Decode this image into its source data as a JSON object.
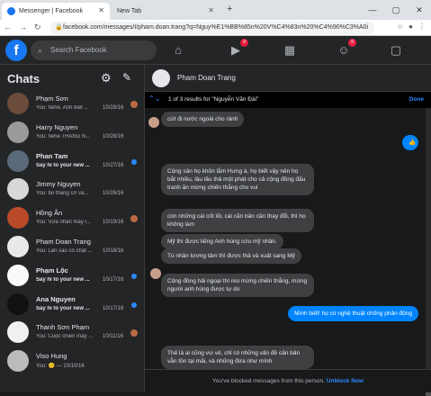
{
  "browser": {
    "active_tab_title": "Messenger | Facebook",
    "inactive_tab_title": "New Tab",
    "new_tab_glyph": "+",
    "url": "facebook.com/messages/t/pham.doan.trang?q=Nguy%E1%BB%85n%20V%C4%83n%20%C4%90%C3%A0i",
    "window_controls": [
      "—",
      "▢",
      "✕"
    ]
  },
  "fb": {
    "search_placeholder": "Search Facebook",
    "badge_watch": "9",
    "badge_groups": "9",
    "brand_color": "#1877f2"
  },
  "sidebar": {
    "title": "Chats",
    "chats": [
      {
        "name": "Phạm Sơn",
        "preview": "You: hehe. Anh biết ...",
        "date": "10/28/16",
        "avatar_color": "#6b4b3a",
        "state": "seen"
      },
      {
        "name": "Harry Nguyen",
        "preview": "You: hehe THẰNG N...",
        "date": "10/28/16",
        "avatar_color": "#9a9a9a",
        "state": "none"
      },
      {
        "name": "Phan Tam",
        "preview": "Say hi to your new ...",
        "date": "10/27/16",
        "avatar_color": "#5a6a7a",
        "state": "unread"
      },
      {
        "name": "Jimmy Nguyen",
        "preview": "You: bỏ thằng cờ và...",
        "date": "10/26/16",
        "avatar_color": "#d8d8d8",
        "state": "none"
      },
      {
        "name": "Hồng Ân",
        "preview": "You: Vừa nhắn mấy l...",
        "date": "10/19/16",
        "avatar_color": "#b84a2a",
        "state": "seen"
      },
      {
        "name": "Pham Doan Trang",
        "preview": "You: Lần sau có chat ...",
        "date": "10/18/16",
        "avatar_color": "#e8e8e8",
        "state": "none"
      },
      {
        "name": "Phạm Lộc",
        "preview": "Say hi to your new ...",
        "date": "10/17/16",
        "avatar_color": "#fafafa",
        "state": "unread"
      },
      {
        "name": "Ana Nguyen",
        "preview": "Say hi to your new ...",
        "date": "10/17/16",
        "avatar_color": "#111111",
        "state": "unread"
      },
      {
        "name": "Thanh Sơn Phạm",
        "preview": "You: Cuộc chiến mấy ...",
        "date": "10/11/16",
        "avatar_color": "#f0f0f0",
        "state": "seen"
      },
      {
        "name": "Viso Hung",
        "preview": "You: 😊 — 10/10/16",
        "date": "",
        "avatar_color": "#bbbbbb",
        "state": "none"
      }
    ]
  },
  "conversation": {
    "name": "Pham Doan Trang",
    "search_result_text": "1 of 3 results for \"Nguyễn Văn Đài\"",
    "done_label": "Done",
    "messages": [
      {
        "from": "them",
        "text": "cứt đi nước ngoài cho rảnh"
      },
      {
        "from": "me",
        "text": "👍"
      },
      {
        "from": "them",
        "text": "Cộng sản họ khôn lắm Hưng à, họ biết vậy nên họ bắt nhiều, lâu lâu thả một phát cho cả cộng đồng đấu tranh ăn mừng chiến thắng cho vui"
      },
      {
        "from": "them",
        "text": "còn những cái cốt lõi, cái căn bản cần thay đổi, thì họ không làm"
      },
      {
        "from": "them",
        "text": "Mỹ thì được tiếng Anh hùng cứu mỹ nhân."
      },
      {
        "from": "them",
        "text": "Tù nhân lương tâm thì được thả và xuất sang Mỹ"
      },
      {
        "from": "them",
        "text": "Cộng đồng hải ngoại thì reo mừng chiến thắng, mừng người anh hùng được tự do"
      },
      {
        "from": "me",
        "text": "Mình biết! họ có nghệ thuật chống phản động"
      },
      {
        "from": "them",
        "text": "Thế là ai cũng vui vẻ, chỉ có những vấn đề căn bản vẫn tồn tại mãi, và những đứa như mình"
      }
    ],
    "blocked_text": "You've blocked messages from this person.",
    "unblock_label": "Unblock Now"
  }
}
